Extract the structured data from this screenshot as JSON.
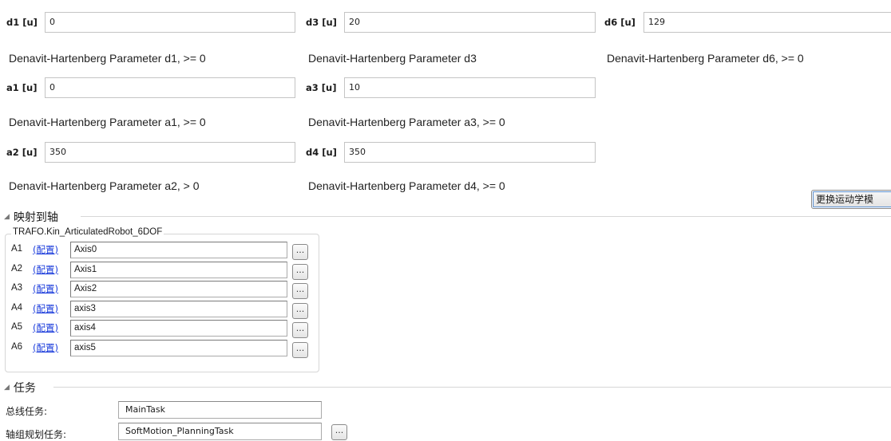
{
  "parameters": [
    {
      "label": "d1 [u]",
      "value": "0",
      "description": "Denavit-Hartenberg Parameter d1, >= 0"
    },
    {
      "label": "d3 [u]",
      "value": "20",
      "description": "Denavit-Hartenberg Parameter d3"
    },
    {
      "label": "d6 [u]",
      "value": "129",
      "description": "Denavit-Hartenberg Parameter d6, >= 0"
    },
    {
      "label": "a1 [u]",
      "value": "0",
      "description": "Denavit-Hartenberg Parameter a1, >= 0"
    },
    {
      "label": "a3 [u]",
      "value": "10",
      "description": "Denavit-Hartenberg Parameter a3, >= 0"
    },
    {
      "label": "a2 [u]",
      "value": "350",
      "description": "Denavit-Hartenberg Parameter a2, > 0"
    },
    {
      "label": "d4 [u]",
      "value": "350",
      "description": "Denavit-Hartenberg Parameter d4, >= 0"
    }
  ],
  "change_kinematics_button": "更换运动学模",
  "mapping": {
    "title": "映射到轴",
    "group_title": "TRAFO.Kin_ArticulatedRobot_6DOF",
    "axes": [
      {
        "name": "A1",
        "link": "(配置)",
        "value": "Axis0",
        "browse": "..."
      },
      {
        "name": "A2",
        "link": "(配置)",
        "value": "Axis1",
        "browse": "..."
      },
      {
        "name": "A3",
        "link": "(配置)",
        "value": "Axis2",
        "browse": "..."
      },
      {
        "name": "A4",
        "link": "(配置)",
        "value": "axis3",
        "browse": "..."
      },
      {
        "name": "A5",
        "link": "(配置)",
        "value": "axis4",
        "browse": "..."
      },
      {
        "name": "A6",
        "link": "(配置)",
        "value": "axis5",
        "browse": "..."
      }
    ]
  },
  "tasks": {
    "title": "任务",
    "bus_task_label": "总线任务:",
    "bus_task_value": "MainTask",
    "planning_task_label": "轴组规划任务:",
    "planning_task_value": "SoftMotion_PlanningTask",
    "browse": "..."
  },
  "colors": {
    "link": "#1a3bdb",
    "focus": "#5a8fd0"
  }
}
